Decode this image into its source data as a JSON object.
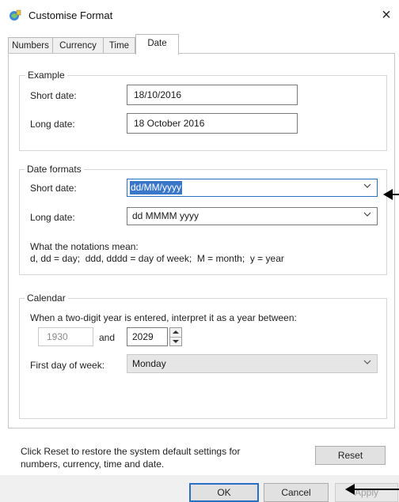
{
  "window": {
    "title": "Customise Format",
    "close_symbol": "×"
  },
  "tabs": [
    {
      "label": "Numbers"
    },
    {
      "label": "Currency"
    },
    {
      "label": "Time"
    },
    {
      "label": "Date",
      "active": true
    }
  ],
  "example": {
    "group_label": "Example",
    "short_label": "Short date:",
    "short_value": "18/10/2016",
    "long_label": "Long date:",
    "long_value": "18 October 2016"
  },
  "date_formats": {
    "group_label": "Date formats",
    "short_label": "Short date:",
    "short_value": "dd/MM/yyyy",
    "long_label": "Long date:",
    "long_value": "dd MMMM yyyy",
    "notations_title": "What the notations mean:",
    "notations_text": "d, dd = day;  ddd, dddd = day of week;  M = month;  y = year"
  },
  "calendar": {
    "group_label": "Calendar",
    "two_digit_text": "When a two-digit year is entered, interpret it as a year between:",
    "from_year": "1930",
    "and_text": "and",
    "to_year": "2029",
    "first_day_label": "First day of week:",
    "first_day_value": "Monday"
  },
  "footer": {
    "reset_text_line1": "Click Reset to restore the system default settings for",
    "reset_text_line2": "numbers, currency, time and date.",
    "reset_button": "Reset"
  },
  "buttons": {
    "ok": "OK",
    "cancel": "Cancel",
    "apply": "Apply"
  },
  "colors": {
    "selection": "#3a77c8",
    "focus_border": "#2b6fc5",
    "dialog_bg": "#ffffff",
    "button_bg": "#e1e1e1"
  }
}
